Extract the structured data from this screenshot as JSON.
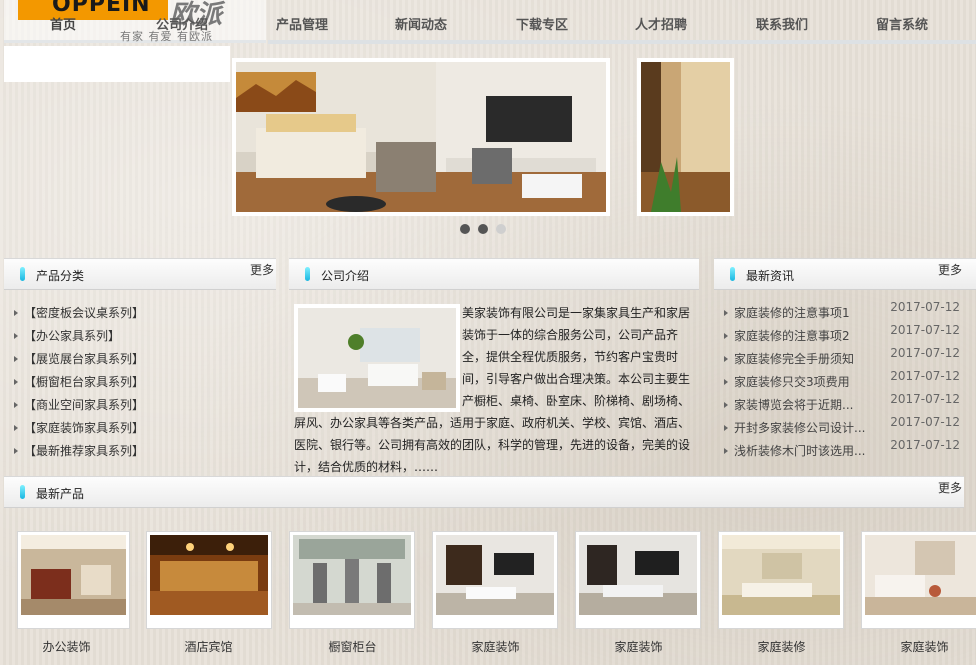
{
  "header": {
    "logo_text": "OPPEIN",
    "logo_script": "欧派",
    "slogan": "有家 有爱 有欧派",
    "nav": [
      "首页",
      "公司介绍",
      "产品管理",
      "新闻动态",
      "下载专区",
      "人才招聘",
      "联系我们",
      "留言系统"
    ]
  },
  "slider": {
    "slide_count": 3,
    "active_index": 2
  },
  "categories": {
    "title": "产品分类",
    "more": "更多",
    "items": [
      "【密度板会议桌系列】",
      "【办公家具系列】",
      "【展览展台家具系列】",
      "【橱窗柜台家具系列】",
      "【商业空间家具系列】",
      "【家庭装饰家具系列】",
      "【最新推荐家具系列】"
    ]
  },
  "about": {
    "title": "公司介绍",
    "text": "美家装饰有限公司是一家集家具生产和家居装饰于一体的综合服务公司，公司产品齐全，提供全程优质服务，节约客户宝贵时间，引导客户做出合理决策。本公司主要生产橱柜、桌椅、卧室床、阶梯椅、剧场椅、屏风、办公家具等各类产品，适用于家庭、政府机关、学校、宾馆、酒店、医院、银行等。公司拥有高效的团队，科学的管理，先进的设备，完美的设计，结合优质的材料，……"
  },
  "news": {
    "title": "最新资讯",
    "more": "更多",
    "items": [
      {
        "title": "家庭装修的注意事项1",
        "date": "2017-07-12"
      },
      {
        "title": "家庭装修的注意事项2",
        "date": "2017-07-12"
      },
      {
        "title": "家庭装修完全手册须知",
        "date": "2017-07-12"
      },
      {
        "title": "家庭装修只交3项费用",
        "date": "2017-07-12"
      },
      {
        "title": "家装博览会将于近期...",
        "date": "2017-07-12"
      },
      {
        "title": "开封多家装修公司设计...",
        "date": "2017-07-12"
      },
      {
        "title": "浅析装修木门时该选用...",
        "date": "2017-07-12"
      }
    ]
  },
  "products": {
    "title": "最新产品",
    "more": "更多",
    "items": [
      "办公装饰",
      "酒店宾馆",
      "橱窗柜台",
      "家庭装饰",
      "家庭装饰",
      "家庭装修",
      "家庭装饰"
    ]
  },
  "colors": {
    "accent": "#19b6e0",
    "logo_orange": "#f39800"
  }
}
